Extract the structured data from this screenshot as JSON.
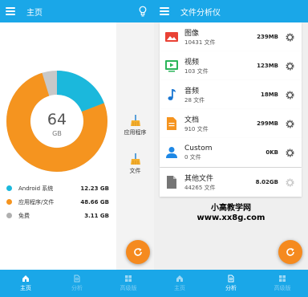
{
  "left": {
    "title": "主页",
    "icon": "bulb-icon",
    "chart": {
      "center_value": "64",
      "center_unit": "GB",
      "colors": {
        "android": "#1bb8dc",
        "apps": "#f5941f",
        "free": "#c8c8c8"
      }
    },
    "legend": [
      {
        "label": "Android 系统",
        "value": "12.23 GB",
        "color": "#1bb8dc"
      },
      {
        "label": "应用程序/文件",
        "value": "48.66 GB",
        "color": "#f5941f"
      },
      {
        "label": "免费",
        "value": "3.11 GB",
        "color": "#b0b0b0"
      }
    ],
    "side": [
      {
        "label": "应用程序",
        "icon": "broom-icon"
      },
      {
        "label": "文件",
        "icon": "broom-icon"
      }
    ],
    "nav": [
      {
        "label": "主页",
        "icon": "home-icon"
      },
      {
        "label": "分析",
        "icon": "document-search-icon"
      },
      {
        "label": "高级版",
        "icon": "grid-icon"
      }
    ]
  },
  "right": {
    "title": "文件分析仪",
    "cards": [
      {
        "name": "图像",
        "count": "10431 文件",
        "size": "239MB",
        "icon": "image-icon",
        "color": "#e94235"
      },
      {
        "name": "视频",
        "count": "103 文件",
        "size": "123MB",
        "icon": "video-icon",
        "color": "#2bb55a"
      },
      {
        "name": "音频",
        "count": "28 文件",
        "size": "18MB",
        "icon": "music-icon",
        "color": "#1976d2"
      },
      {
        "name": "文档",
        "count": "910 文件",
        "size": "299MB",
        "icon": "document-icon",
        "color": "#f5941f"
      },
      {
        "name": "Custom",
        "count": "0 文件",
        "size": "0KB",
        "icon": "person-icon",
        "color": "#1e88e5"
      },
      {
        "name": "其他文件",
        "count": "44265 文件",
        "size": "8.02GB",
        "icon": "file-icon",
        "color": "#757575"
      }
    ],
    "nav": [
      {
        "label": "主页",
        "icon": "home-icon"
      },
      {
        "label": "分析",
        "icon": "document-search-icon"
      },
      {
        "label": "高级版",
        "icon": "grid-icon"
      }
    ]
  },
  "watermark": {
    "line1": "小高教学网",
    "line2": "www.xx8g.com"
  }
}
